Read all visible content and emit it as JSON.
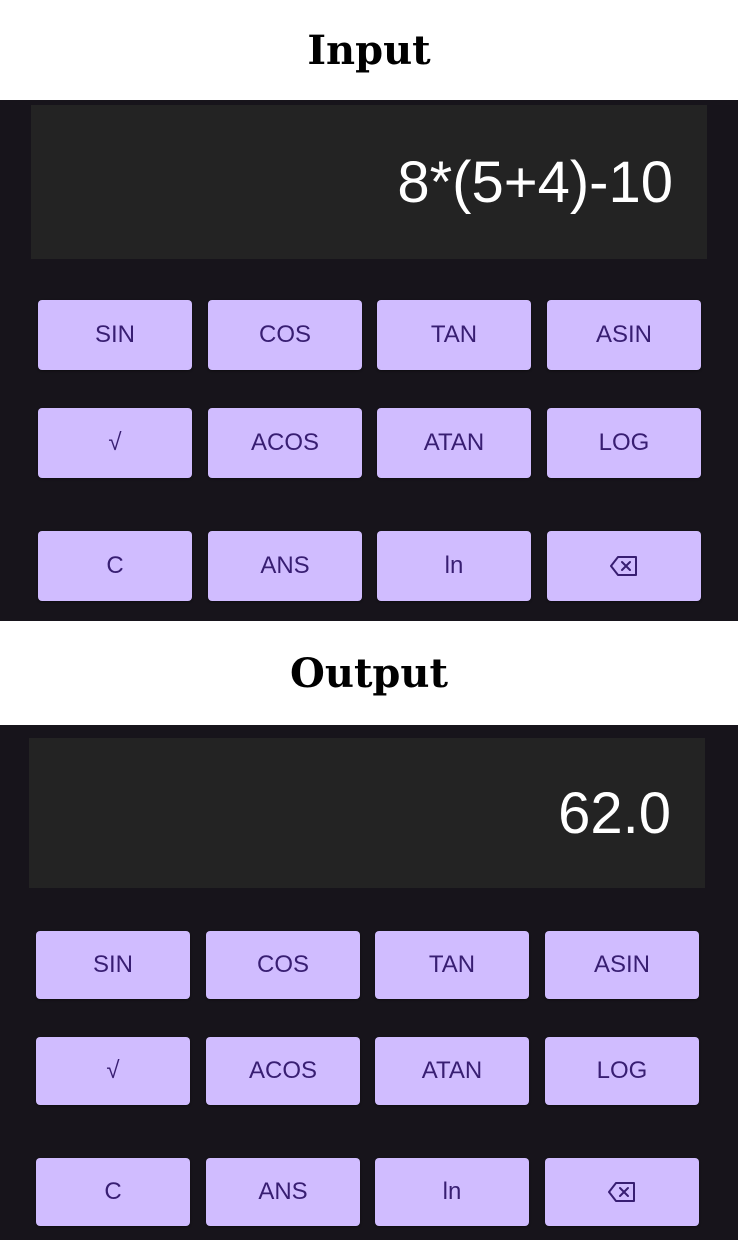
{
  "captions": {
    "input": "Input",
    "output": "Output"
  },
  "input_screen": {
    "display": "8*(5+4)-10"
  },
  "output_screen": {
    "display": "62.0"
  },
  "keys": {
    "sin": "SIN",
    "cos": "COS",
    "tan": "TAN",
    "asin": "ASIN",
    "sqrt": "√",
    "acos": "ACOS",
    "atan": "ATAN",
    "log": "LOG",
    "clear": "C",
    "ans": "ANS",
    "ln": "ln",
    "backspace_icon": "backspace-icon"
  },
  "colors": {
    "panel_bg": "#17141b",
    "display_bg": "#232323",
    "button_bg": "#d0bcff",
    "button_text": "#381e72",
    "display_text": "#ffffff"
  }
}
